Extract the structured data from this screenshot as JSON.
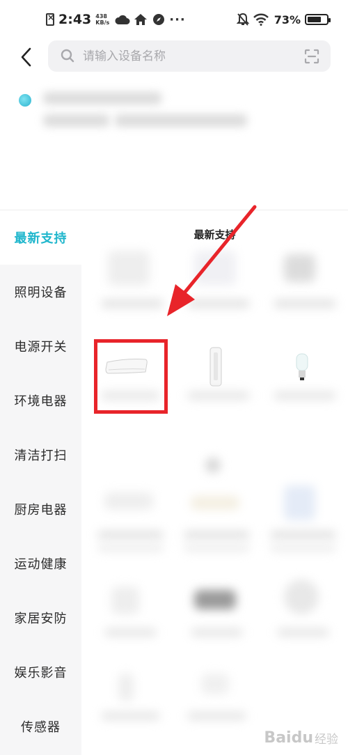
{
  "status_bar": {
    "time": "2:43",
    "net_speed_value": "438",
    "net_speed_unit": "KB/s",
    "more": "···",
    "battery_percent": "73%",
    "battery_level": 0.73
  },
  "search": {
    "placeholder": "请输入设备名称"
  },
  "sidebar": {
    "items": [
      {
        "label": "最新支持",
        "active": true
      },
      {
        "label": "照明设备",
        "active": false
      },
      {
        "label": "电源开关",
        "active": false
      },
      {
        "label": "环境电器",
        "active": false
      },
      {
        "label": "清洁打扫",
        "active": false
      },
      {
        "label": "厨房电器",
        "active": false
      },
      {
        "label": "运动健康",
        "active": false
      },
      {
        "label": "家居安防",
        "active": false
      },
      {
        "label": "娱乐影音",
        "active": false
      },
      {
        "label": "传感器",
        "active": false
      }
    ]
  },
  "content": {
    "section_title": "最新支持"
  },
  "annotation": {
    "color": "#e8242a"
  },
  "watermark": {
    "text": "Baidu",
    "sub": "经验"
  },
  "colors": {
    "accent": "#1fb6cc",
    "sidebar_bg": "#f6f6f7"
  }
}
